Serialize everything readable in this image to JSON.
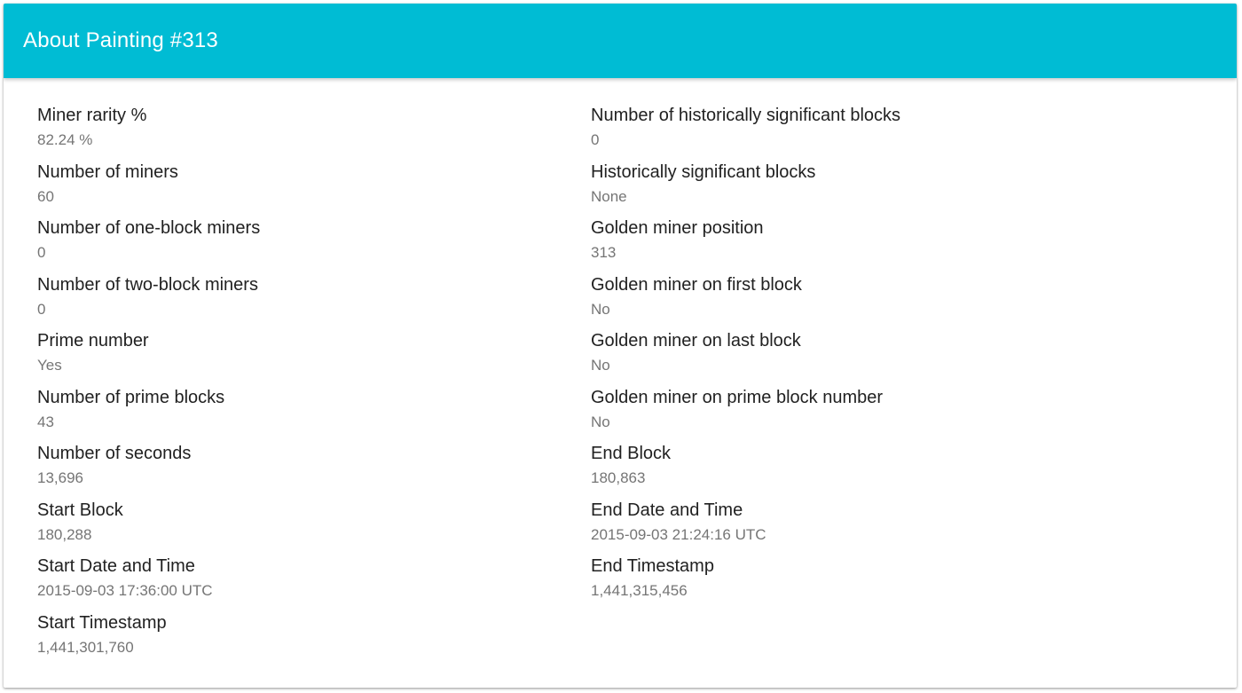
{
  "header": {
    "title": "About Painting #313"
  },
  "left": [
    {
      "label": "Miner rarity %",
      "value": "82.24 %"
    },
    {
      "label": "Number of miners",
      "value": "60"
    },
    {
      "label": "Number of one-block miners",
      "value": "0"
    },
    {
      "label": "Number of two-block miners",
      "value": "0"
    },
    {
      "label": "Prime number",
      "value": "Yes"
    },
    {
      "label": "Number of prime blocks",
      "value": "43"
    },
    {
      "label": "Number of seconds",
      "value": "13,696"
    },
    {
      "label": "Start Block",
      "value": "180,288"
    },
    {
      "label": "Start Date and Time",
      "value": "2015-09-03 17:36:00 UTC"
    },
    {
      "label": "Start Timestamp",
      "value": "1,441,301,760"
    }
  ],
  "right": [
    {
      "label": "Number of historically significant blocks",
      "value": "0"
    },
    {
      "label": "Historically significant blocks",
      "value": "None"
    },
    {
      "label": "Golden miner position",
      "value": "313"
    },
    {
      "label": "Golden miner on first block",
      "value": "No"
    },
    {
      "label": "Golden miner on last block",
      "value": "No"
    },
    {
      "label": "Golden miner on prime block number",
      "value": "No"
    },
    {
      "label": "End Block",
      "value": "180,863"
    },
    {
      "label": "End Date and Time",
      "value": "2015-09-03 21:24:16 UTC"
    },
    {
      "label": "End Timestamp",
      "value": "1,441,315,456"
    }
  ]
}
